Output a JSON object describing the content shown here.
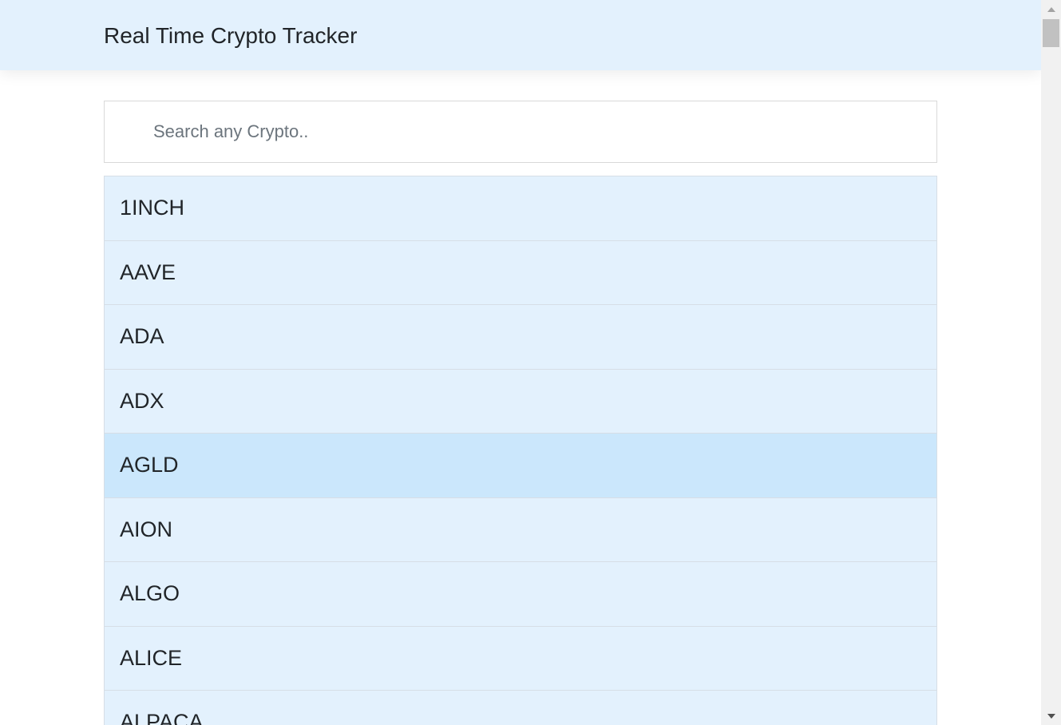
{
  "header": {
    "title": "Real Time Crypto Tracker"
  },
  "search": {
    "placeholder": "Search any Crypto..",
    "value": ""
  },
  "colors": {
    "header_bg": "#e3f1fd",
    "item_bg": "#e3f1fd",
    "item_hover_bg": "#cbe7fc"
  },
  "crypto_list": {
    "hovered_index": 4,
    "items": [
      {
        "label": "1INCH"
      },
      {
        "label": "AAVE"
      },
      {
        "label": "ADA"
      },
      {
        "label": "ADX"
      },
      {
        "label": "AGLD"
      },
      {
        "label": "AION"
      },
      {
        "label": "ALGO"
      },
      {
        "label": "ALICE"
      },
      {
        "label": "ALPACA"
      }
    ]
  }
}
